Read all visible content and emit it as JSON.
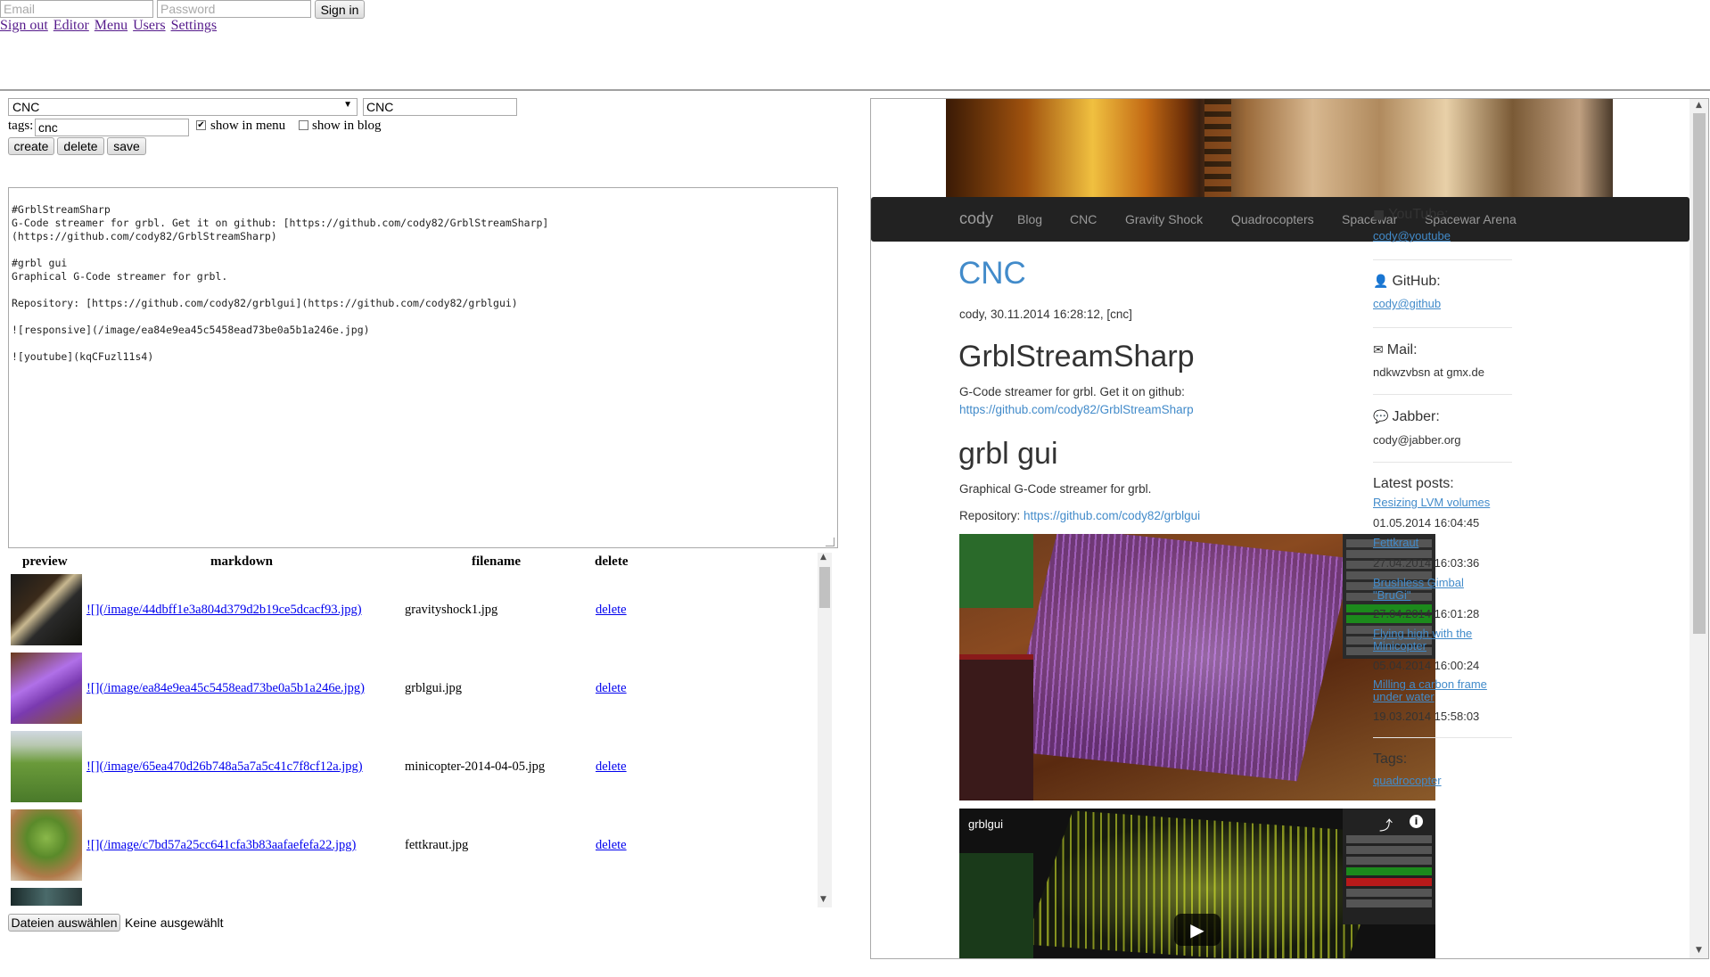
{
  "topbar": {
    "email_placeholder": "Email",
    "password_placeholder": "Password",
    "signin_label": "Sign in",
    "links": [
      "Sign out",
      "Editor",
      "Menu",
      "Users",
      "Settings"
    ]
  },
  "editor": {
    "page_select_value": "CNC",
    "title_value": "CNC",
    "tags_label": "tags:",
    "tags_value": "cnc",
    "show_in_menu_label": "show in menu",
    "show_in_menu_checked": true,
    "show_in_blog_label": "show in blog",
    "show_in_blog_checked": false,
    "create_label": "create",
    "delete_label": "delete",
    "save_label": "save",
    "markdown": "#GrblStreamSharp\nG-Code streamer for grbl. Get it on github: [https://github.com/cody82/GrblStreamSharp]\n(https://github.com/cody82/GrblStreamSharp)\n\n#grbl gui\nGraphical G-Code streamer for grbl.\n\nRepository: [https://github.com/cody82/grblgui](https://github.com/cody82/grblgui)\n\n![responsive](/image/ea84e9ea45c5458ead73be0a5b1a246e.jpg)\n\n![youtube](kqCFuzl11s4)"
  },
  "images": {
    "headers": {
      "preview": "preview",
      "markdown": "markdown",
      "filename": "filename",
      "delete": "delete"
    },
    "rows": [
      {
        "markdown": "![](/image/44dbff1e3a804d379d2b19ce5dcacf93.jpg)",
        "filename": "gravityshock1.jpg",
        "delete": "delete"
      },
      {
        "markdown": "![](/image/ea84e9ea45c5458ead73be0a5b1a246e.jpg)",
        "filename": "grblgui.jpg",
        "delete": "delete"
      },
      {
        "markdown": "![](/image/65ea470d26b748a5a7a5c41c7f8cf12a.jpg)",
        "filename": "minicopter-2014-04-05.jpg",
        "delete": "delete"
      },
      {
        "markdown": "![](/image/c7bd57a25cc641cfa3b83aafaefefa22.jpg)",
        "filename": "fettkraut.jpg",
        "delete": "delete"
      }
    ],
    "file_button_label": "Dateien auswählen",
    "file_status": "Keine ausgewählt"
  },
  "preview": {
    "nav": {
      "brand": "cody",
      "items": [
        "Blog",
        "CNC",
        "Gravity Shock",
        "Quadrocopters",
        "Spacewar",
        "Spacewar Arena"
      ]
    },
    "page_title": "CNC",
    "meta": "cody, 30.11.2014 16:28:12, [cnc]",
    "h1_first": "GrblStreamSharp",
    "p_first": "G-Code streamer for grbl. Get it on github:",
    "link_first": "https://github.com/cody82/GrblStreamSharp",
    "h1_second": "grbl gui",
    "p_second": "Graphical G-Code streamer for grbl.",
    "repo_label": "Repository:",
    "repo_link": "https://github.com/cody82/grblgui",
    "video_title": "grblgui",
    "sidebar": {
      "youtube_label": "YouTube:",
      "youtube_link": "cody@youtube",
      "github_label": "GitHub:",
      "github_link": "cody@github",
      "mail_label": "Mail:",
      "mail_value": "ndkwzvbsn at gmx.de",
      "jabber_label": "Jabber:",
      "jabber_value": "cody@jabber.org",
      "latest_label": "Latest posts:",
      "posts": [
        {
          "title": "Resizing LVM volumes",
          "date": "01.05.2014 16:04:45"
        },
        {
          "title": "Fettkraut",
          "date": "27.04.2014 16:03:36"
        },
        {
          "title": "Brushless Gimbal \"BruGi\"",
          "date": "27.04.2014 16:01:28"
        },
        {
          "title": "Flying high with the Minicopter",
          "date": "05.04.2014 16:00:24"
        },
        {
          "title": "Milling a carbon frame under water",
          "date": "19.03.2014 15:58:03"
        }
      ],
      "tags_label": "Tags:",
      "first_tag": "quadrocopter"
    }
  }
}
